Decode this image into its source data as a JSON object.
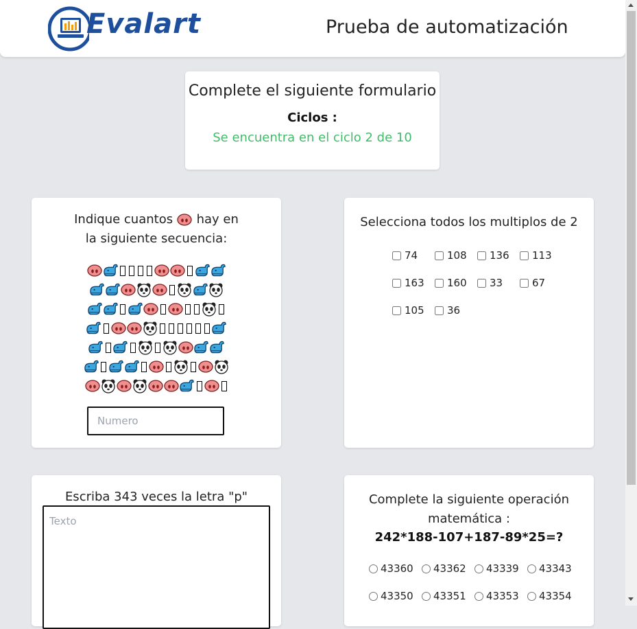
{
  "header": {
    "logo_text": "Evalart",
    "title": "Prueba de automatización"
  },
  "status_card": {
    "title": "Complete el siguiente formulario",
    "cycles_label": "Ciclos :",
    "cycles_text": "Se encuentra en el ciclo 2 de 10"
  },
  "sequence_card": {
    "question_prefix": "Indique cuantos",
    "question_target_icon": "pig-nose-icon",
    "question_suffix": "hay en",
    "question_line2": "la siguiente secuencia:",
    "sequence_rows": [
      [
        "pig-nose",
        "whale",
        "box",
        "box",
        "box",
        "box",
        "pig-nose",
        "pig-nose",
        "box",
        "whale",
        "whale"
      ],
      [
        "whale",
        "whale",
        "pig-nose",
        "panda",
        "pig-nose",
        "box",
        "panda",
        "whale",
        "panda"
      ],
      [
        "whale",
        "whale",
        "box",
        "whale",
        "pig-nose",
        "box",
        "pig-nose",
        "box",
        "box",
        "panda",
        "box"
      ],
      [
        "whale",
        "box",
        "pig-nose",
        "pig-nose",
        "panda",
        "box",
        "box",
        "box",
        "box",
        "box",
        "box",
        "whale"
      ],
      [
        "whale",
        "box",
        "whale",
        "box",
        "panda",
        "box",
        "panda",
        "pig-nose",
        "whale",
        "whale"
      ],
      [
        "whale",
        "box",
        "whale",
        "whale",
        "box",
        "pig-nose",
        "box",
        "panda",
        "box",
        "pig-nose",
        "panda"
      ],
      [
        "pig-nose",
        "panda",
        "pig-nose",
        "panda",
        "pig-nose",
        "pig-nose",
        "whale",
        "box",
        "pig-nose",
        "box"
      ]
    ],
    "input_placeholder": "Numero",
    "input_value": ""
  },
  "multiples_card": {
    "question": "Selecciona todos los multiplos de 2",
    "options": [
      [
        "74",
        "108",
        "136",
        "113"
      ],
      [
        "163",
        "160",
        "33",
        "67"
      ],
      [
        "105",
        "36"
      ]
    ]
  },
  "text_card": {
    "question": "Escriba 343 veces la letra \"p\"",
    "textarea_placeholder": "Texto",
    "textarea_value": ""
  },
  "math_card": {
    "question_line1": "Complete la siguiente operación",
    "question_line2": "matemática :",
    "expression": "242*188-107+187-89*25=?",
    "options": [
      [
        "43360",
        "43362",
        "43339",
        "43343"
      ],
      [
        "43350",
        "43351",
        "43353",
        "43354"
      ]
    ]
  },
  "colors": {
    "accent_green": "#3ebd67",
    "logo_blue": "#1e4f9c",
    "page_bg": "#e5e7eb"
  }
}
